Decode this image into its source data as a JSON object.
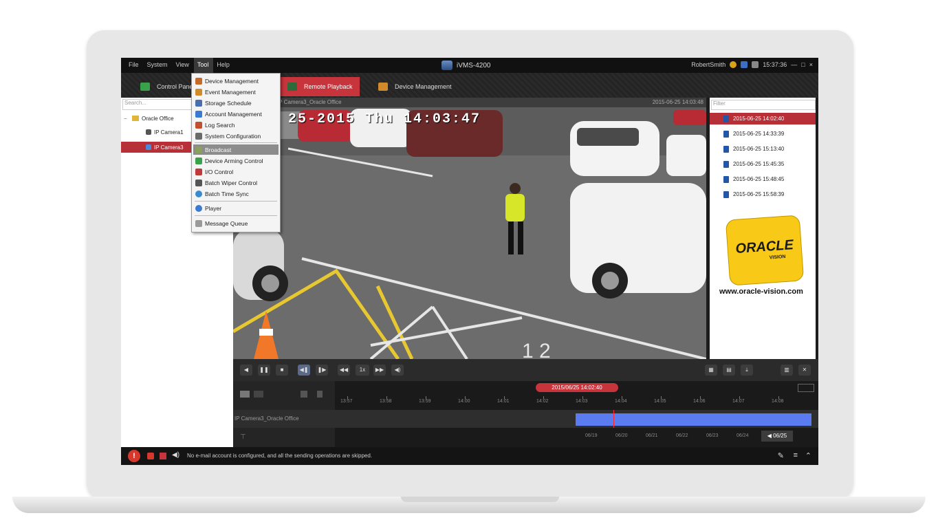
{
  "window": {
    "menu": [
      "File",
      "System",
      "View",
      "Tool",
      "Help"
    ],
    "app_title": "iVMS-4200",
    "user": "RobertSmith",
    "clock": "15:37:36",
    "controls": [
      "—",
      "□",
      "×"
    ]
  },
  "tabs": [
    {
      "label": "Control Panel"
    },
    {
      "label": "Remote Playback"
    },
    {
      "label": "Device Management"
    }
  ],
  "left_panel": {
    "search_placeholder": "Search...",
    "tree": [
      {
        "label": "Oracle Office"
      },
      {
        "label": "IP Camera1"
      },
      {
        "label": "IP Camera3"
      }
    ]
  },
  "tool_menu": {
    "items": [
      {
        "label": "Device Management",
        "color": "#c46a2a"
      },
      {
        "label": "Event Management",
        "color": "#d08a2a"
      },
      {
        "label": "Storage Schedule",
        "color": "#4a6fae"
      },
      {
        "label": "Account Management",
        "color": "#3a7ad0"
      },
      {
        "label": "Log Search",
        "color": "#c05030"
      },
      {
        "label": "System Configuration",
        "color": "#6a6a6a"
      },
      {
        "label": "Broadcast",
        "color": "#8aa060"
      },
      {
        "label": "Device Arming Control",
        "color": "#3aa04a"
      },
      {
        "label": "I/O Control",
        "color": "#c03a3a"
      },
      {
        "label": "Batch Wiper Control",
        "color": "#555555"
      },
      {
        "label": "Batch Time Sync",
        "color": "#3a8ad0"
      },
      {
        "label": "Player",
        "color": "#3a7ad0"
      },
      {
        "label": "Message Queue",
        "color": "#9a9a9a"
      }
    ]
  },
  "video": {
    "header_left": "IP Camera3_Oracle Office",
    "header_right": "2015-06-25 14:03:48",
    "osd": "25-2015 Thu 14:03:47"
  },
  "records": {
    "filter_placeholder": "Filter",
    "items": [
      "2015-06-25 14:02:40",
      "2015-06-25 14:33:39",
      "2015-06-25 15:13:40",
      "2015-06-25 15:45:35",
      "2015-06-25 15:48:45",
      "2015-06-25 15:58:39"
    ]
  },
  "brand": {
    "name": "ORACLE",
    "sub": "VISION",
    "url": "www.oracle-vision.com",
    "color": "#f8c916"
  },
  "playback": {
    "speed": "1x"
  },
  "timeline": {
    "current_time": "2015/06/25 14:02:40",
    "ticks": [
      "13:57",
      "13:58",
      "13:59",
      "14:00",
      "14:01",
      "14:02",
      "14:03",
      "14:04",
      "14:05",
      "14:06",
      "14:07",
      "14:08"
    ],
    "camera_label": "IP Camera3_Oracle Office",
    "dates": [
      "06/19",
      "06/20",
      "06/21",
      "06/22",
      "06/23",
      "06/24"
    ],
    "active_date": "06/25",
    "record_color": "#5a7cf0"
  },
  "status": {
    "message": "No e-mail account is configured, and all the sending operations are skipped."
  }
}
